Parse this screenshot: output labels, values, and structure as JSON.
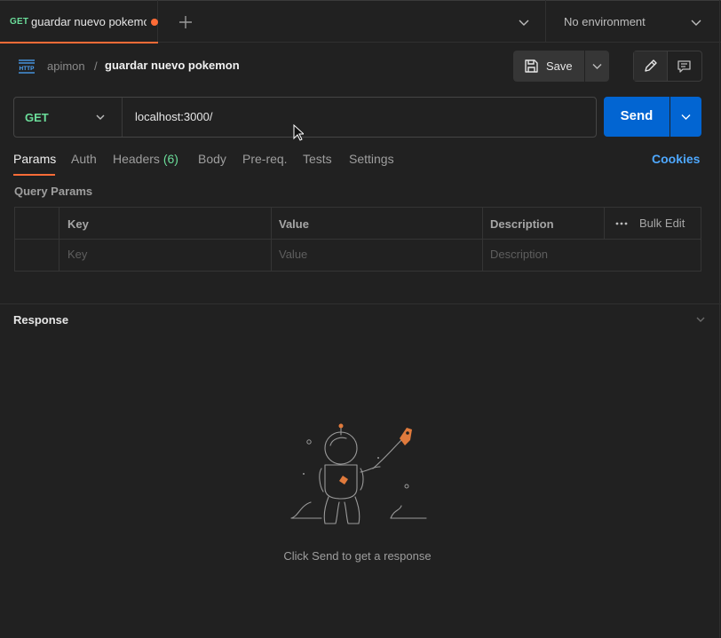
{
  "tab": {
    "method": "GET",
    "title": "guardar nuevo pokemon",
    "unsaved": true
  },
  "environment": {
    "selected": "No environment"
  },
  "breadcrumb": {
    "parent": "apimon",
    "separator": "/",
    "current": "guardar nuevo pokemon"
  },
  "toolbar": {
    "save_label": "Save"
  },
  "request": {
    "method": "GET",
    "url": "localhost:3000/",
    "send_label": "Send"
  },
  "request_tabs": {
    "params": "Params",
    "auth": "Auth",
    "headers": "Headers",
    "headers_count": "(6)",
    "body": "Body",
    "prereq": "Pre-req.",
    "tests": "Tests",
    "settings": "Settings",
    "cookies": "Cookies"
  },
  "query_params": {
    "title": "Query Params",
    "columns": {
      "key": "Key",
      "value": "Value",
      "description": "Description",
      "bulk_edit": "Bulk Edit"
    },
    "placeholders": {
      "key": "Key",
      "value": "Value",
      "description": "Description"
    }
  },
  "response": {
    "title": "Response",
    "empty_message": "Click Send to get a response"
  },
  "colors": {
    "accent": "#ff6c37",
    "method_get": "#6bdd9a",
    "send": "#0265d2",
    "link": "#4ea8ff"
  }
}
